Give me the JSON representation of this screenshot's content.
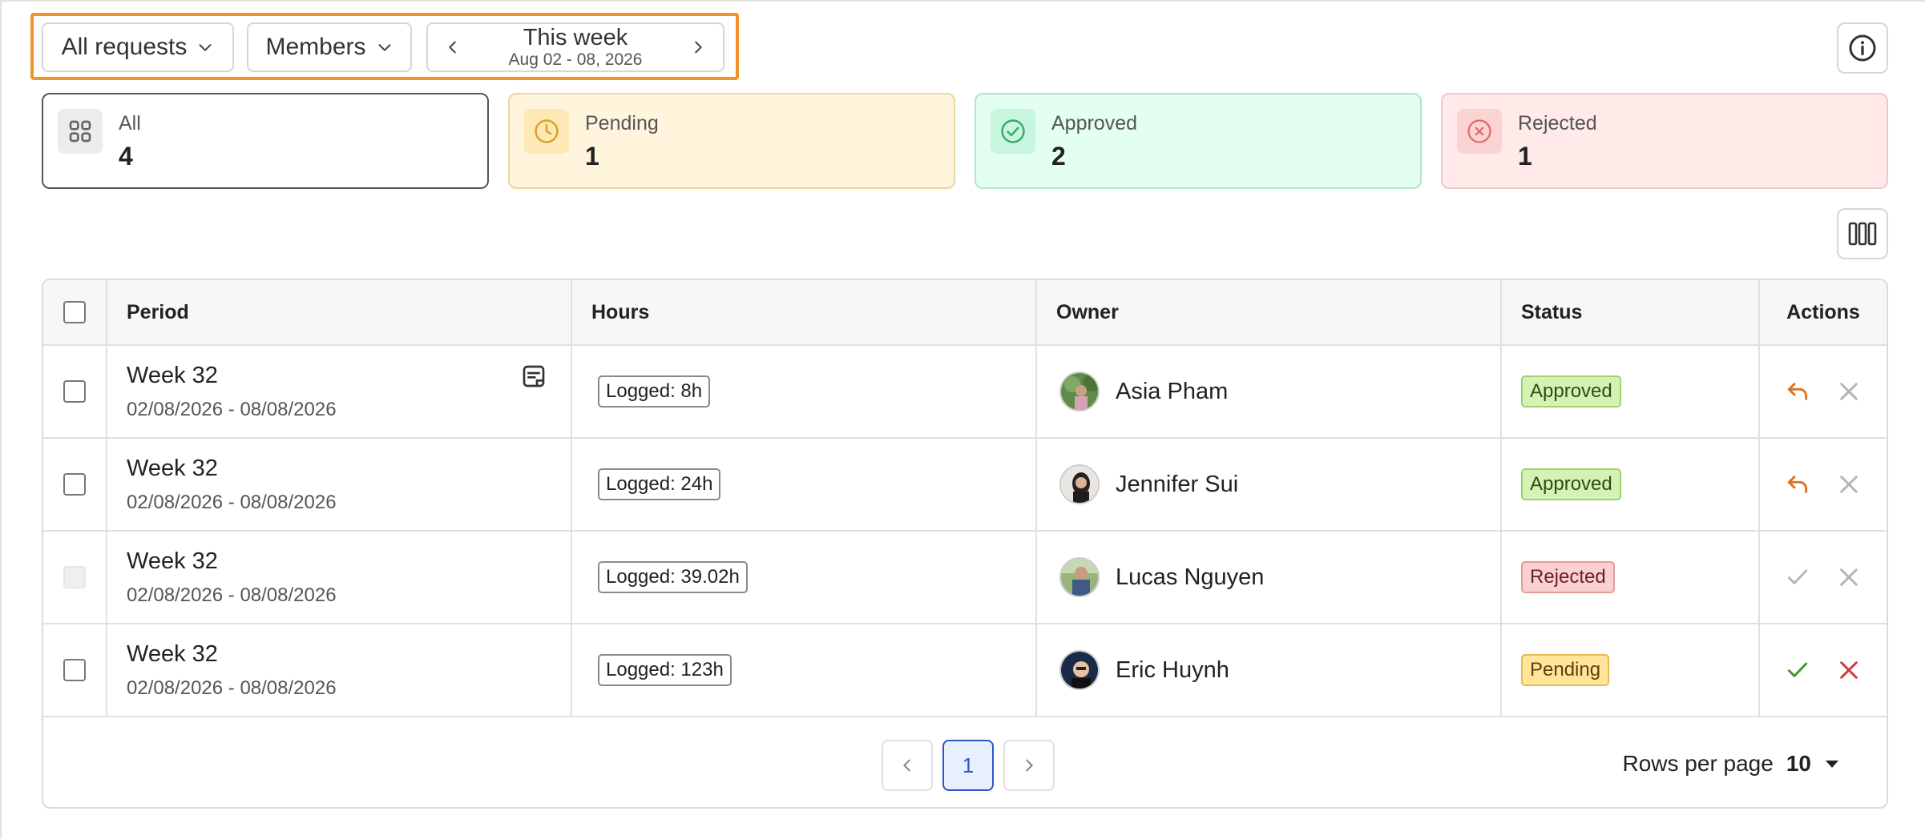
{
  "filters": {
    "request_type": "All requests",
    "members": "Members",
    "week_title": "This week",
    "week_range": "Aug 02 - 08, 2026"
  },
  "summary": [
    {
      "label": "All",
      "count": "4",
      "bg": "#ffffff",
      "border": "#555555",
      "icon_bg": "#ececec",
      "icon_color": "#666666",
      "icon": "grid-icon"
    },
    {
      "label": "Pending",
      "count": "1",
      "bg": "#fff5dd",
      "border": "#e8d7a3",
      "icon_bg": "#fde8b6",
      "icon_color": "#d9a521",
      "icon": "clock-icon"
    },
    {
      "label": "Approved",
      "count": "2",
      "bg": "#e2fff1",
      "border": "#b4e5cd",
      "icon_bg": "#c8f5dd",
      "icon_color": "#3aad70",
      "icon": "check-circle-icon"
    },
    {
      "label": "Rejected",
      "count": "1",
      "bg": "#ffe9e9",
      "border": "#efc9c9",
      "icon_bg": "#fcd3d3",
      "icon_color": "#e36a6a",
      "icon": "x-circle-icon"
    }
  ],
  "table": {
    "headers": {
      "period": "Period",
      "hours": "Hours",
      "owner": "Owner",
      "status": "Status",
      "actions": "Actions"
    },
    "rows": [
      {
        "period_title": "Week 32",
        "period_dates": "02/08/2026 - 08/08/2026",
        "hours": "Logged: 8h",
        "owner": "Asia Pham",
        "status": "Approved",
        "has_note": true
      },
      {
        "period_title": "Week 32",
        "period_dates": "02/08/2026 - 08/08/2026",
        "hours": "Logged: 24h",
        "owner": "Jennifer Sui",
        "status": "Approved",
        "has_note": false
      },
      {
        "period_title": "Week 32",
        "period_dates": "02/08/2026 - 08/08/2026",
        "hours": "Logged: 39.02h",
        "owner": "Lucas Nguyen",
        "status": "Rejected",
        "has_note": false
      },
      {
        "period_title": "Week 32",
        "period_dates": "02/08/2026 - 08/08/2026",
        "hours": "Logged: 123h",
        "owner": "Eric Huynh",
        "status": "Pending",
        "has_note": false
      }
    ]
  },
  "pagination": {
    "current_page": "1",
    "rows_per_page_label": "Rows per page",
    "rows_per_page_value": "10"
  },
  "colors": {
    "highlight": "#f0932b",
    "revert": "#e0731f",
    "approve": "#3f9a2b",
    "reject": "#d23b3b",
    "muted": "#b5b5b5"
  }
}
